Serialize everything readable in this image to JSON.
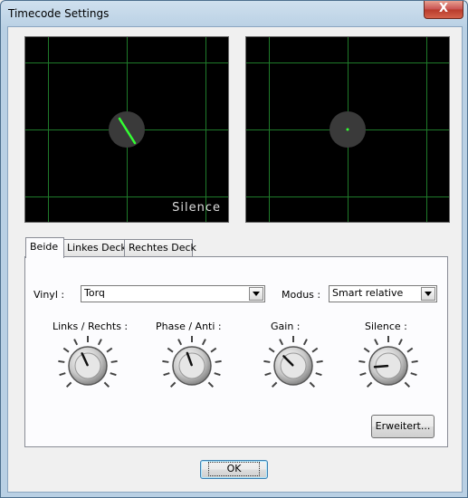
{
  "window": {
    "title": "Timecode Settings",
    "close_symbol": "X"
  },
  "scopes": {
    "left": {
      "overlay_text": "Silence",
      "needle_angle_deg": -30
    },
    "right": {
      "overlay_text": ""
    }
  },
  "tabs": [
    {
      "label": "Beide",
      "active": true
    },
    {
      "label": "Linkes Deck",
      "active": false
    },
    {
      "label": "Rechtes Deck",
      "active": false
    }
  ],
  "vinyl": {
    "label": "Vinyl :",
    "value": "Torq"
  },
  "modus": {
    "label": "Modus :",
    "value": "Smart relative"
  },
  "knobs": [
    {
      "label": "Links / Rechts :",
      "angle_deg": -25
    },
    {
      "label": "Phase / Anti :",
      "angle_deg": -20
    },
    {
      "label": "Gain :",
      "angle_deg": -45
    },
    {
      "label": "Silence :",
      "angle_deg": -95
    }
  ],
  "buttons": {
    "advanced": "Erweitert...",
    "ok": "OK"
  },
  "colors": {
    "scope_bg": "#000000",
    "grid": "#1f7a2a",
    "needle": "#33ff33",
    "titlebar": "#b9d0e4"
  }
}
